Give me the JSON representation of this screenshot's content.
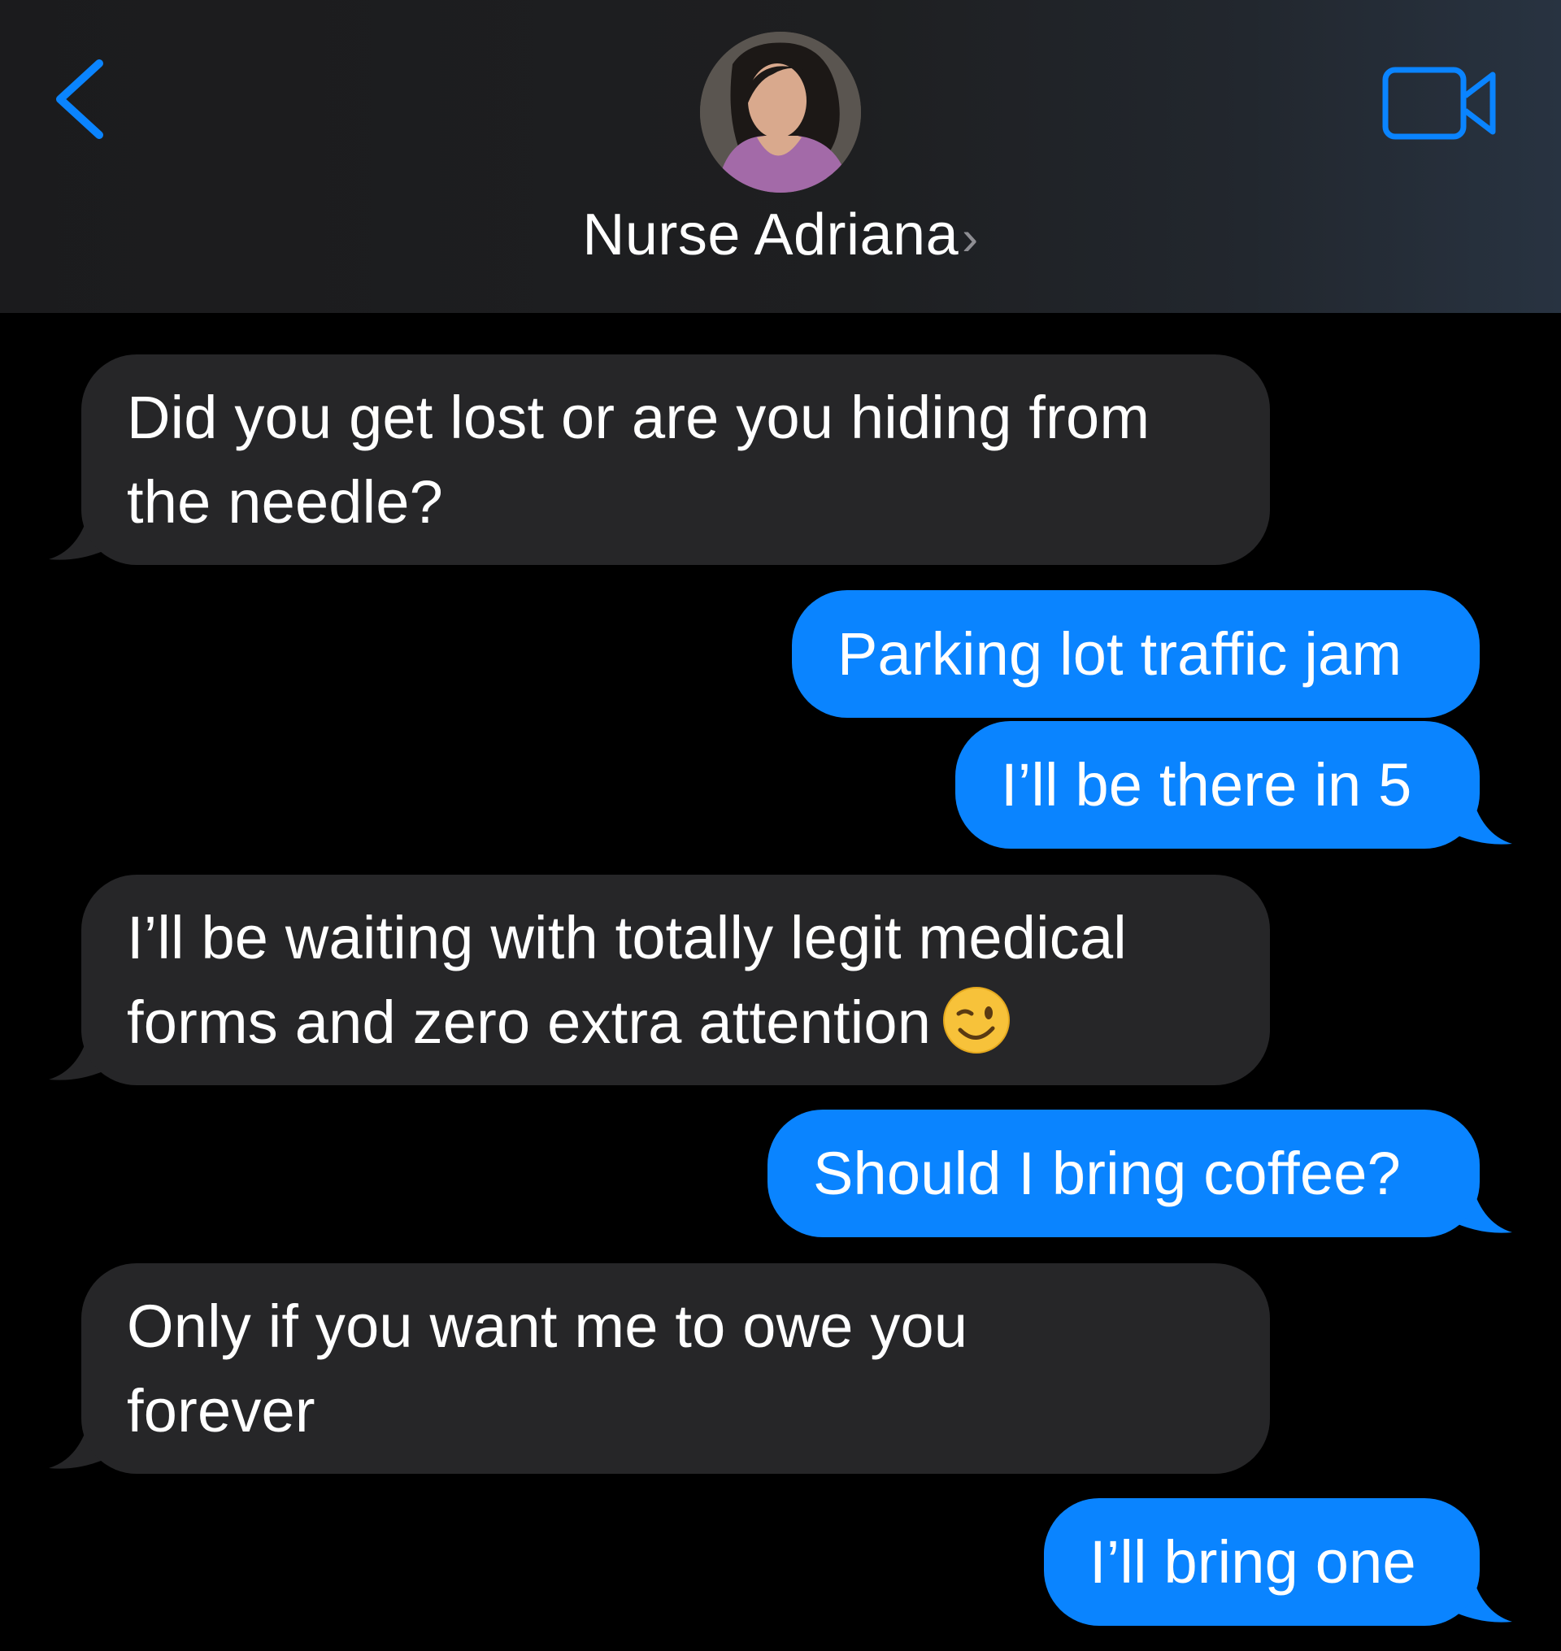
{
  "header": {
    "contact_name": "Nurse Adriana",
    "name_chevron": "›",
    "back_icon": "chevron-left-icon",
    "video_icon": "video-camera-icon",
    "accent_color": "#0a84ff"
  },
  "messages": [
    {
      "direction": "incoming",
      "text": "Did you get lost or are you hiding from the needle?"
    },
    {
      "direction": "outgoing",
      "text": "Parking lot traffic jam"
    },
    {
      "direction": "outgoing",
      "text": "I’ll be there in 5"
    },
    {
      "direction": "incoming",
      "text": "I’ll be waiting with totally legit medical forms and zero extra attention",
      "emoji": "winking-face-emoji"
    },
    {
      "direction": "outgoing",
      "text": "Should I bring coffee?"
    },
    {
      "direction": "incoming",
      "text": "Only if you want me to owe you forever"
    },
    {
      "direction": "outgoing",
      "text": "I’ll bring one"
    }
  ],
  "colors": {
    "incoming_bubble": "#262628",
    "outgoing_bubble": "#0a84ff",
    "background": "#000000"
  }
}
